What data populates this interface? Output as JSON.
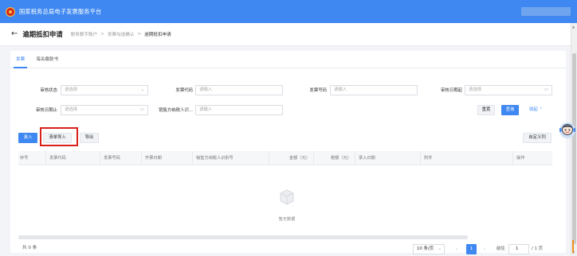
{
  "topbar": {
    "title": "国家税务总局电子发票服务平台",
    "emblem_icon": "tax-emblem-icon"
  },
  "page": {
    "title": "逾期抵扣申请",
    "breadcrumb": [
      "税务数字账户",
      "发票勾选确认",
      "逾期抵扣申请"
    ],
    "breadcrumb_sep": ">"
  },
  "tabs": [
    {
      "label": "发票",
      "active": true
    },
    {
      "label": "海关缴款书",
      "active": false
    }
  ],
  "filters": {
    "review_status": {
      "label": "审核状态",
      "placeholder": "请选择"
    },
    "invoice_code": {
      "label": "发票代码",
      "placeholder": "请输入"
    },
    "invoice_number": {
      "label": "发票号码",
      "placeholder": "请输入"
    },
    "review_date_from": {
      "label": "审核日期起",
      "placeholder": "请选择"
    },
    "review_date_to": {
      "label": "审核日期止",
      "placeholder": "请选择"
    },
    "seller_taxid": {
      "label": "销售方纳税人识...",
      "placeholder": "请输入"
    }
  },
  "actions": {
    "reset": "重置",
    "query": "查询",
    "collapse": "收起"
  },
  "toolbar": {
    "enter": "录入",
    "batch_import": "清单导入",
    "export": "导出",
    "custom_columns": "自定义列"
  },
  "table": {
    "columns": [
      "序号",
      "发票代码",
      "发票号码",
      "开票日期",
      "销售方纳税人识别号",
      "金额（元）",
      "税额（元）",
      "录入日期",
      "附件",
      "操作"
    ],
    "empty_text": "暂无数据"
  },
  "pagination": {
    "total": "共 0 条",
    "page_size": "10 条/页",
    "current_page": "1",
    "jump_label": "前往",
    "jump_value": "1",
    "total_pages": "/ 1 页"
  },
  "colors": {
    "primary": "#3f88f2",
    "highlight": "#d9201a"
  }
}
